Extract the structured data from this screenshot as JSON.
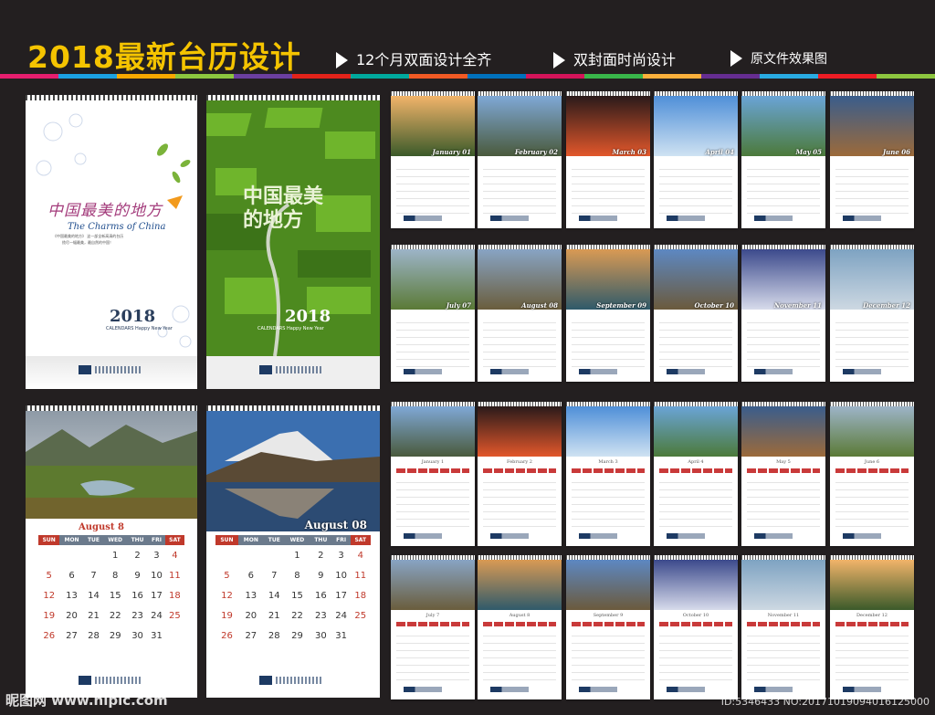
{
  "header": {
    "title": "2018最新台历设计",
    "features": [
      "12个月双面设计全齐",
      "双封面时尚设计",
      "原文件效果图"
    ]
  },
  "stripe_colors": [
    "#e61e6e",
    "#1ba1e2",
    "#f7a800",
    "#8cc63f",
    "#6b3fa0",
    "#e2231a",
    "#00a99d",
    "#f15a24",
    "#0071bc",
    "#d4145a",
    "#39b54a",
    "#fbb03b",
    "#662d91",
    "#29abe2",
    "#ed1c24",
    "#8dc63f"
  ],
  "cover1": {
    "chinese_title": "中国最美的地方",
    "english_title": "The Charms of China",
    "tagline": "《中国最美的地方》 这一部全新高清的台历",
    "tagline2": "揽尽一幅最美，最自然的中国！",
    "year": "2018",
    "calendars": "CALENDARS",
    "happy": "Happy New Year"
  },
  "cover2": {
    "chinese_title": "中国最美的地方",
    "year": "2018",
    "calendars": "CALENDARS",
    "happy": "Happy New Year"
  },
  "months_en": [
    "January 01",
    "February 02",
    "March 03",
    "April 04",
    "May 05",
    "June 06",
    "July 07",
    "August 08",
    "September 09",
    "October 10",
    "November 11",
    "December 12"
  ],
  "months_b": [
    "January 1",
    "February 2",
    "March 3",
    "April 4",
    "May 5",
    "June 6",
    "July 7",
    "August 8",
    "September 9",
    "October 10",
    "November 11",
    "December 12"
  ],
  "big_a": {
    "month_label": "August 8",
    "weekdays": [
      "SUN",
      "MON",
      "TUE",
      "WED",
      "THU",
      "FRI",
      "SAT"
    ],
    "rows": [
      [
        "",
        "",
        "",
        "1",
        "2",
        "3",
        "4"
      ],
      [
        "5",
        "6",
        "7",
        "8",
        "9",
        "10",
        "11"
      ],
      [
        "12",
        "13",
        "14",
        "15",
        "16",
        "17",
        "18"
      ],
      [
        "19",
        "20",
        "21",
        "22",
        "23",
        "24",
        "25"
      ],
      [
        "26",
        "27",
        "28",
        "29",
        "30",
        "31",
        ""
      ]
    ]
  },
  "big_b": {
    "month_label": "August 08",
    "weekdays": [
      "SUN",
      "MON",
      "TUE",
      "WED",
      "THU",
      "FRI",
      "SAT"
    ],
    "rows": [
      [
        "",
        "",
        "",
        "1",
        "2",
        "3",
        "4"
      ],
      [
        "5",
        "6",
        "7",
        "8",
        "9",
        "10",
        "11"
      ],
      [
        "12",
        "13",
        "14",
        "15",
        "16",
        "17",
        "18"
      ],
      [
        "19",
        "20",
        "21",
        "22",
        "23",
        "24",
        "25"
      ],
      [
        "26",
        "27",
        "28",
        "29",
        "30",
        "31",
        ""
      ]
    ]
  },
  "watermark_left": "昵图网 www.nipic.com",
  "watermark_right": "ID:5346433 NO:20171019094016125000"
}
